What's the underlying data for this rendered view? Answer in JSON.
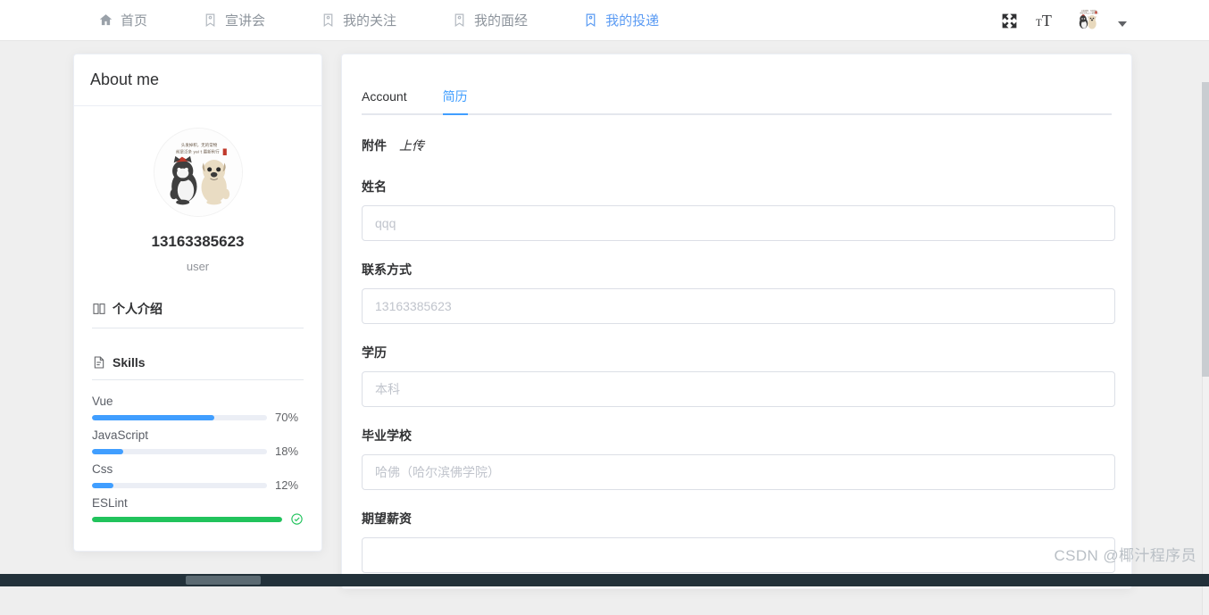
{
  "navbar": {
    "items": [
      {
        "label": "首页",
        "icon": "home-icon",
        "active": false
      },
      {
        "label": "宣讲会",
        "icon": "tag-icon",
        "active": false
      },
      {
        "label": "我的关注",
        "icon": "tag-icon",
        "active": false
      },
      {
        "label": "我的面经",
        "icon": "tag-icon",
        "active": false
      },
      {
        "label": "我的投递",
        "icon": "tag-icon",
        "active": true
      }
    ],
    "actions": {
      "fullscreen": "fullscreen-icon",
      "text_size": "text-size-icon",
      "avatar": "avatar-image",
      "dropdown": "chevron-down-icon"
    },
    "active_color": "#5b9bf3"
  },
  "left_card": {
    "header_title": "About me",
    "avatar_alt": "cat-and-pug-avatar",
    "username": "13163385623",
    "role": "user",
    "sections": [
      {
        "title": "个人介绍",
        "icon": "book-icon"
      },
      {
        "title": "Skills",
        "icon": "document-icon"
      }
    ],
    "skills": [
      {
        "name": "Vue",
        "percent": 70,
        "label": "70%",
        "color": "#409eff",
        "done": false
      },
      {
        "name": "JavaScript",
        "percent": 18,
        "label": "18%",
        "color": "#409eff",
        "done": false
      },
      {
        "name": "Css",
        "percent": 12,
        "label": "12%",
        "color": "#409eff",
        "done": false
      },
      {
        "name": "ESLint",
        "percent": 100,
        "label": "",
        "color": "#21c35c",
        "done": true
      }
    ]
  },
  "right_card": {
    "tabs": [
      {
        "label": "Account",
        "active": false
      },
      {
        "label": "简历",
        "active": true
      }
    ],
    "attachment": {
      "label": "附件",
      "link": "上传"
    },
    "fields": [
      {
        "label": "姓名",
        "value": "qqq",
        "placeholder": "qqq"
      },
      {
        "label": "联系方式",
        "value": "13163385623",
        "placeholder": "13163385623"
      },
      {
        "label": "学历",
        "value": "本科",
        "placeholder": "本科"
      },
      {
        "label": "毕业学校",
        "value": "哈佛（哈尔滨佛学院）",
        "placeholder": "哈佛（哈尔滨佛学院）"
      },
      {
        "label": "期望薪资",
        "value": "",
        "placeholder": ""
      }
    ]
  },
  "watermark": "CSDN @椰汁程序员",
  "colors": {
    "primary": "#409eff",
    "success": "#21c35c",
    "page_bg": "#efefef",
    "bottom_bar": "#22313a"
  }
}
